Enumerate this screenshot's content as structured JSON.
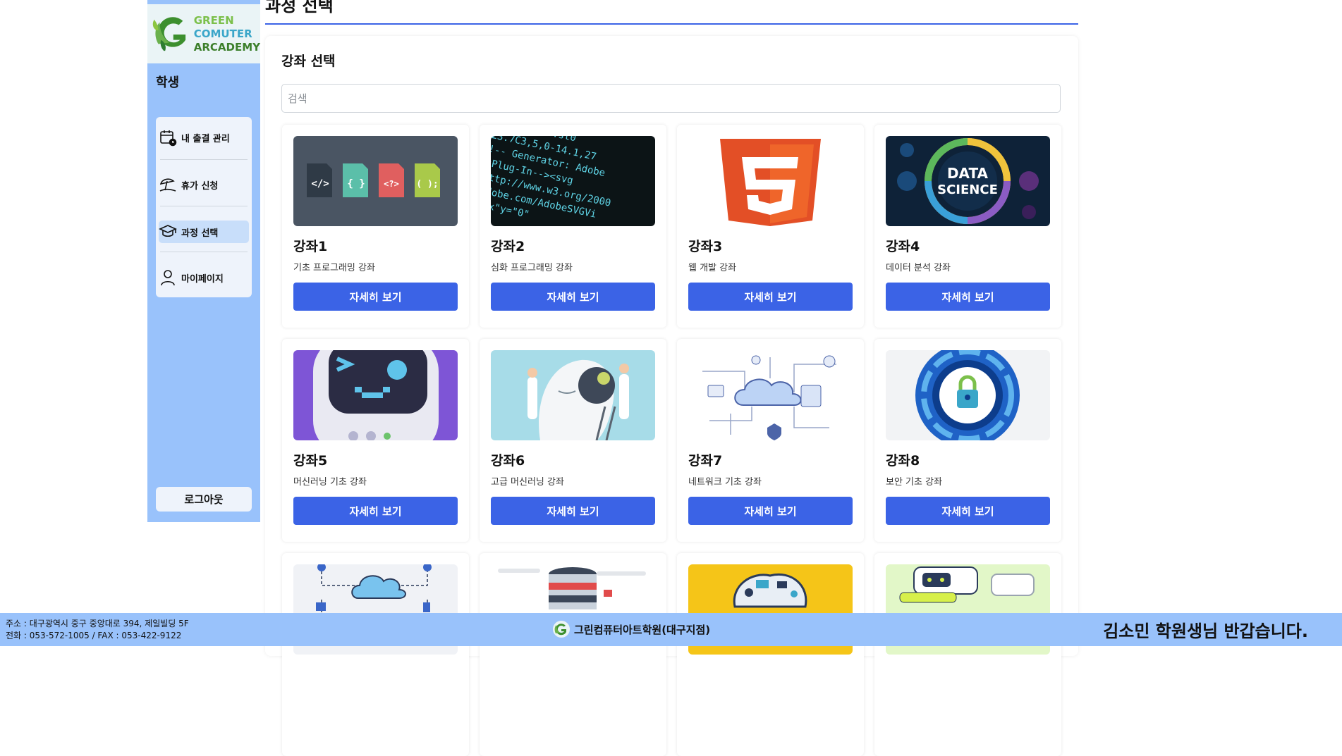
{
  "brand": {
    "line1": "GREEN",
    "line2": "COMUTER",
    "line3": "ARCADEMY"
  },
  "sidebar": {
    "role": "학생",
    "items": [
      {
        "label": "내 출결 관리",
        "icon": "calendar-icon"
      },
      {
        "label": "휴가 신청",
        "icon": "beach-umbrella-icon"
      },
      {
        "label": "과정 선택",
        "icon": "graduation-cap-icon"
      },
      {
        "label": "마이페이지",
        "icon": "user-icon"
      }
    ],
    "logout": "로그아웃"
  },
  "page": {
    "title": "과정 선택"
  },
  "panel": {
    "title": "강좌 선택",
    "search_placeholder": "검색"
  },
  "courses": [
    {
      "title": "강좌1",
      "desc": "기초 프로그래밍 강좌",
      "button": "자세히 보기",
      "image": "code-files-icon"
    },
    {
      "title": "강좌2",
      "desc": "심화 프로그래밍 강좌",
      "button": "자세히 보기",
      "image": "source-code-image"
    },
    {
      "title": "강좌3",
      "desc": "웹 개발 강좌",
      "button": "자세히 보기",
      "image": "html5-logo"
    },
    {
      "title": "강좌4",
      "desc": "데이터 분석 강좌",
      "button": "자세히 보기",
      "image": "data-science-image"
    },
    {
      "title": "강좌5",
      "desc": "머신러닝 기초 강좌",
      "button": "자세히 보기",
      "image": "robot-face-image"
    },
    {
      "title": "강좌6",
      "desc": "고급 머신러닝 강좌",
      "button": "자세히 보기",
      "image": "ai-head-image"
    },
    {
      "title": "강좌7",
      "desc": "네트워크 기초 강좌",
      "button": "자세히 보기",
      "image": "cloud-network-image"
    },
    {
      "title": "강좌8",
      "desc": "보안 기초 강좌",
      "button": "자세히 보기",
      "image": "security-lock-image"
    }
  ],
  "partial_cards": [
    "cloud-storage-image",
    "database-server-image",
    "circuit-brain-image",
    "robot-machine-image"
  ],
  "footer": {
    "address": "주소 : 대구광역시 중구 중앙대로 394, 제일빌딩 5F",
    "phone": "전화 : 053-572-1005 / FAX : 053-422-9122",
    "academy": "그린컴퓨터아트학원(대구지점)",
    "welcome": "김소민 학원생님 반갑습니다."
  },
  "colors": {
    "accent": "#3b63e6",
    "sidebar": "#99c2fb"
  }
}
